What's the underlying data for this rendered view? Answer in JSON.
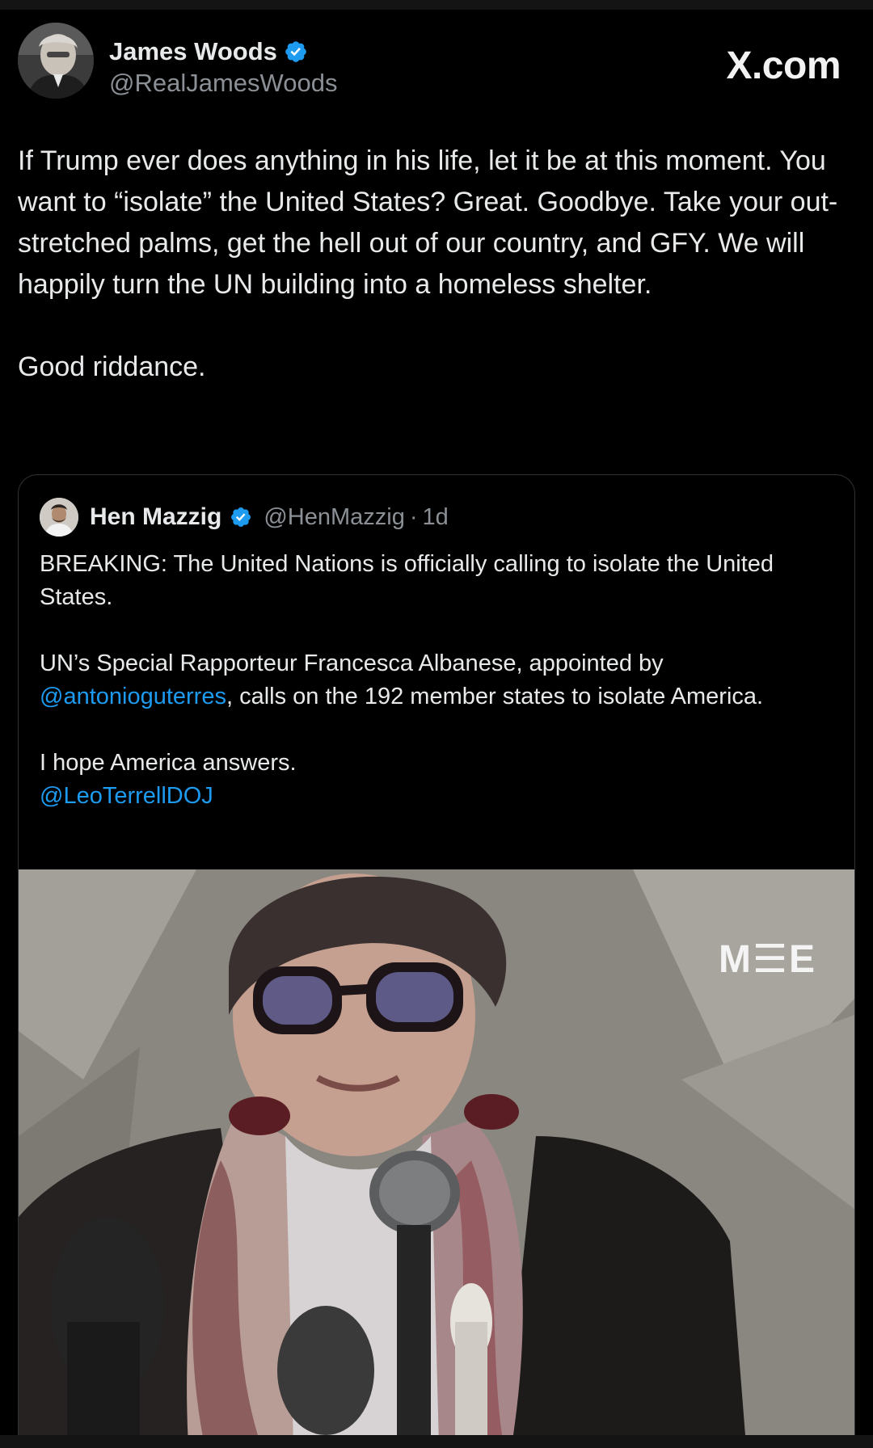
{
  "site": {
    "brand": "X.com"
  },
  "tweet": {
    "author": {
      "display_name": "James Woods",
      "handle": "@RealJamesWoods",
      "verified": true
    },
    "text_paragraphs": [
      "If Trump ever does anything in his life, let it be at this moment. You want to “isolate” the United States? Great. Goodbye. Take your out-stretched palms, get the hell out of our country, and GFY. We will happily turn the UN building into a homeless shelter.",
      "Good riddance."
    ]
  },
  "quoted_tweet": {
    "author": {
      "display_name": "Hen Mazzig",
      "handle": "@HenMazzig",
      "separator": "·",
      "time": "1d",
      "verified": true
    },
    "paragraph_1": "BREAKING: The United Nations is officially calling to isolate the United States.",
    "paragraph_2": {
      "before": "UN’s Special Rapporteur Francesca Albanese, appointed by ",
      "mention": "@antonioguterres",
      "after": ", calls on the 192 member states to isolate America."
    },
    "paragraph_3": {
      "text": "I hope America answers.",
      "mention": "@LeoTerrellDOJ"
    },
    "media": {
      "watermark": "M☰E"
    }
  },
  "colors": {
    "background": "#000000",
    "text": "#e7e9ea",
    "secondary_text": "#8b9096",
    "link": "#1d9bf0",
    "verified_badge": "#1d9bf0",
    "card_border": "#2f3336"
  },
  "icons": {
    "verified": "verified-badge-icon"
  }
}
